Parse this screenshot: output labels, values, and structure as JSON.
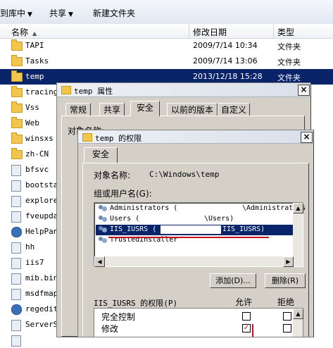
{
  "toolbar": {
    "items": [
      "到库中",
      "共享",
      "新建文件夹"
    ]
  },
  "columns": {
    "name": "名称",
    "modified": "修改日期",
    "type": "类型"
  },
  "files": [
    {
      "name": "TAPI",
      "date": "2009/7/14 10:34",
      "type": "文件夹"
    },
    {
      "name": "Tasks",
      "date": "2009/7/14 13:06",
      "type": "文件夹"
    },
    {
      "name": "temp",
      "date": "2013/12/18 15:28",
      "type": "文件夹"
    },
    {
      "name": "tracing",
      "date": "",
      "type": ""
    },
    {
      "name": "Vss",
      "date": "",
      "type": ""
    },
    {
      "name": "Web",
      "date": "",
      "type": ""
    },
    {
      "name": "winsxs",
      "date": "",
      "type": ""
    },
    {
      "name": "zh-CN",
      "date": "",
      "type": ""
    },
    {
      "name": "bfsvc",
      "date": "",
      "type": ""
    },
    {
      "name": "bootsta",
      "date": "",
      "type": ""
    },
    {
      "name": "explorer",
      "date": "",
      "type": ""
    },
    {
      "name": "fveupda",
      "date": "",
      "type": ""
    },
    {
      "name": "HelpPane",
      "date": "",
      "type": ""
    },
    {
      "name": "hh",
      "date": "",
      "type": ""
    },
    {
      "name": "iis7",
      "date": "",
      "type": ""
    },
    {
      "name": "mib.bin",
      "date": "",
      "type": ""
    },
    {
      "name": "msdfmap",
      "date": "",
      "type": ""
    },
    {
      "name": "regedit",
      "date": "",
      "type": ""
    },
    {
      "name": "ServerS",
      "date": "",
      "type": ""
    },
    {
      "name": "",
      "date": "",
      "type": ""
    }
  ],
  "properties_window": {
    "title": "temp 属性",
    "close": "×",
    "tabs": [
      "常规",
      "共享",
      "安全",
      "以前的版本",
      "自定义"
    ],
    "partial_label": "对象名称:"
  },
  "permissions_window": {
    "title": "temp 的权限",
    "close": "×",
    "tab": "安全",
    "object_label": "对象名称:",
    "object_value": "C:\\Windows\\temp",
    "group_label": "组或用户名(G):",
    "groups": [
      {
        "name": "Administrators (",
        "suffix": "\\Administrators"
      },
      {
        "name": "Users (",
        "suffix": "\\Users)"
      },
      {
        "name": "IIS_IUSRS (",
        "suffix": "IIS_IUSRS)"
      },
      {
        "name": "TrustedInstaller",
        "suffix": ""
      }
    ],
    "add_button": "添加(D)...",
    "remove_button": "删除(R)",
    "perm_label": "IIS_IUSRS 的权限(P)",
    "allow_header": "允许",
    "deny_header": "拒绝",
    "permissions": [
      {
        "name": "完全控制",
        "allow": false,
        "deny": false
      },
      {
        "name": "修改",
        "allow": true,
        "deny": false
      }
    ]
  }
}
